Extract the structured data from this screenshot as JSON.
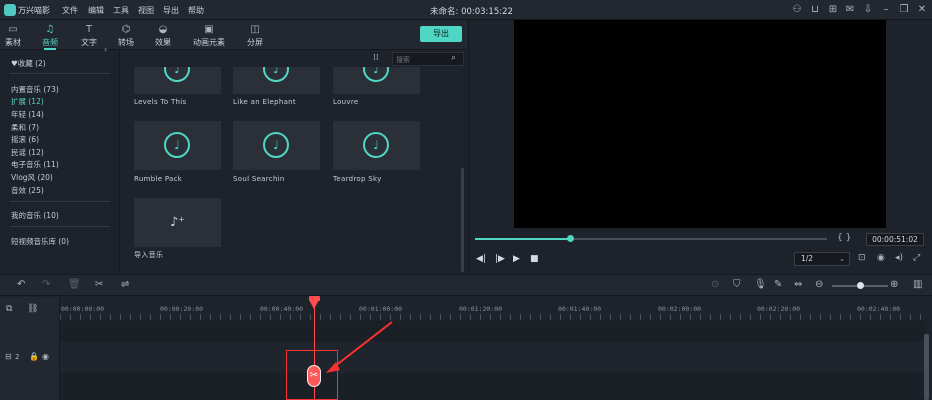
{
  "app": {
    "name": "万兴喵影",
    "menu": [
      "文件",
      "编辑",
      "工具",
      "视图",
      "导出",
      "帮助"
    ],
    "document_title": "未命名: 00:03:15:22",
    "title_icons": [
      "user-icon",
      "cart-icon",
      "gift-icon",
      "mail-icon",
      "download-icon",
      "minimize-icon",
      "restore-icon",
      "close-icon"
    ]
  },
  "tabs": [
    {
      "label": "素材",
      "icon": "media-icon"
    },
    {
      "label": "音频",
      "icon": "music-note-icon",
      "active": true
    },
    {
      "label": "文字",
      "icon": "text-icon"
    },
    {
      "label": "转场",
      "icon": "transition-icon"
    },
    {
      "label": "效果",
      "icon": "effects-icon"
    },
    {
      "label": "动画元素",
      "icon": "image-icon"
    },
    {
      "label": "分屏",
      "icon": "split-screen-icon"
    }
  ],
  "export_label": "导出",
  "library": {
    "favorites": "♥收藏 (2)",
    "categories": [
      {
        "label": "内置音乐 (73)"
      },
      {
        "label": "扩展 (12)",
        "active": true
      },
      {
        "label": "年轻 (14)"
      },
      {
        "label": "柔和 (7)"
      },
      {
        "label": "摇滚 (6)"
      },
      {
        "label": "民谣 (12)"
      },
      {
        "label": "电子音乐 (11)"
      },
      {
        "label": "Vlog风 (20)"
      },
      {
        "label": "音效 (25)"
      }
    ],
    "my_music": "我的音乐 (10)",
    "short_video": "短视频音乐库 (0)",
    "search_placeholder": "搜索",
    "items_row1": [
      "Levels To This",
      "Like an Elephant",
      "Louvre"
    ],
    "items_row2": [
      "Rumble Pack",
      "Soul Searchin",
      "Teardrop Sky"
    ],
    "import_label": "导入音乐"
  },
  "preview": {
    "timecode": "00:00:51:02",
    "ratio": "1/2",
    "progress": 0.27,
    "brackets": "{ }"
  },
  "timeline": {
    "ruler_labels": [
      "00:00:00:00",
      "00:00:20:00",
      "00:00:40:00",
      "00:01:00:00",
      "00:01:20:00",
      "00:01:40:00",
      "00:02:00:00",
      "00:02:20:00",
      "00:02:40:00"
    ],
    "track_label": "2"
  }
}
